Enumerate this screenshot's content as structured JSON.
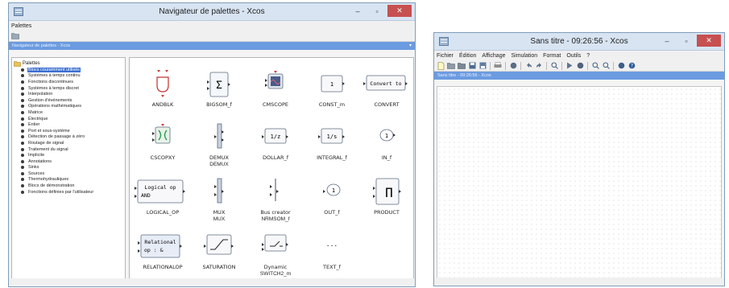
{
  "palette_window": {
    "title": "Navigateur de palettes - Xcos",
    "menu": [
      "Palettes"
    ],
    "panel_title": "Navigateur de palettes - Xcos",
    "tree": {
      "root": "Palettes",
      "items": [
        "Blocs couramment utilisés",
        "Systèmes à temps continu",
        "Fonctions discontinues",
        "Systèmes à temps discret",
        "Interpolation",
        "Gestion d'événements",
        "Opérations mathématiques",
        "Matrice",
        "Électrique",
        "Entier",
        "Port et sous-système",
        "Détection de passage à zéro",
        "Routage de signal",
        "Traitement du signal",
        "Implicite",
        "Annotations",
        "Sinks",
        "Sources",
        "Thermohydrauliques",
        "Blocs de démonstration",
        "Fonctions définies par l'utilisateur"
      ],
      "selected_index": 0
    },
    "blocks": [
      {
        "name": "ANDBLK"
      },
      {
        "name": "BIGSOM_f",
        "icon_text": "Σ"
      },
      {
        "name": "CMSCOPE"
      },
      {
        "name": "CONST_m",
        "icon_text": "1"
      },
      {
        "name": "CONVERT",
        "icon_text": "Convert to"
      },
      {
        "name": "CSCOPXY"
      },
      {
        "name": "DEMUX",
        "caption": "DEMUX"
      },
      {
        "name": "DOLLAR_f",
        "icon_text": "1/z"
      },
      {
        "name": "INTEGRAL_f",
        "icon_text": "1/s"
      },
      {
        "name": "IN_f",
        "icon_text": "1"
      },
      {
        "name": "LOGICAL_OP",
        "icon_text": "Logical op",
        "icon_text2": "AND"
      },
      {
        "name": "MUX",
        "caption": "MUX"
      },
      {
        "name": "NRMSOM_f",
        "caption": "Bus creator"
      },
      {
        "name": "OUT_f",
        "icon_text": "1"
      },
      {
        "name": "PRODUCT",
        "icon_text": "Π"
      },
      {
        "name": "RELATIONALOP",
        "icon_text": "Relational",
        "icon_text2": "op : &"
      },
      {
        "name": "SATURATION"
      },
      {
        "name": "SWITCH2_m",
        "caption": "Dynamic"
      },
      {
        "name": "TEXT_f",
        "icon_text": "..."
      }
    ]
  },
  "diagram_window": {
    "title": "Sans titre - 09:26:56 - Xcos",
    "menu": [
      "Fichier",
      "Édition",
      "Affichage",
      "Simulation",
      "Format",
      "Outils",
      "?"
    ],
    "panel_title": "Sans titre - 09:26:56 - Xcos"
  },
  "colors": {
    "selection": "#3c6fd0",
    "panel_bar": "#6b9be0",
    "close_button": "#c75050",
    "port": "#d23c3c"
  }
}
